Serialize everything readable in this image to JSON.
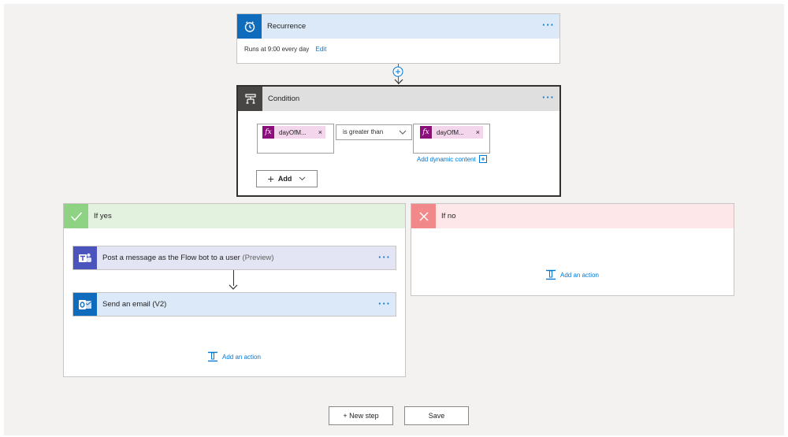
{
  "recurrence": {
    "title": "Recurrence",
    "menu": "···",
    "summary": "Runs at 9:00 every day",
    "edit_link": "Edit",
    "header_color": "#dbe9f8",
    "icon_color": "#0f6cbd",
    "icon": "clock-icon"
  },
  "condition": {
    "title": "Condition",
    "menu": "···",
    "header_color": "#dfdfdf",
    "icon_color": "#484644",
    "icon": "condition-icon",
    "left_operand": {
      "label": "dayOfM...",
      "remove": "×",
      "icon": "fx-icon"
    },
    "operator": "is greater than",
    "right_operand": {
      "label": "dayOfM...",
      "remove": "×",
      "icon": "fx-icon"
    },
    "add_dynamic_content": "Add dynamic content",
    "add_button": "Add",
    "add_plus": "+"
  },
  "branch_yes": {
    "title": "If yes",
    "header_color": "#e3f2df",
    "icon_color": "#8ed383",
    "actions": [
      {
        "title": "Post a message as the Flow bot to a user",
        "badge": "(Preview)",
        "menu": "···",
        "icon": "teams-icon",
        "header_color": "#e4e5f4",
        "icon_color": "#4b53bc"
      },
      {
        "title": "Send an email (V2)",
        "badge": "",
        "menu": "···",
        "icon": "outlook-icon",
        "header_color": "#dbe9f8",
        "icon_color": "#0f6cbd"
      }
    ],
    "add_action": "Add an action"
  },
  "branch_no": {
    "title": "If no",
    "header_color": "#fde7e9",
    "icon_color": "#f1898a",
    "add_action": "Add an action"
  },
  "footer": {
    "new_step": "+ New step",
    "save": "Save"
  }
}
